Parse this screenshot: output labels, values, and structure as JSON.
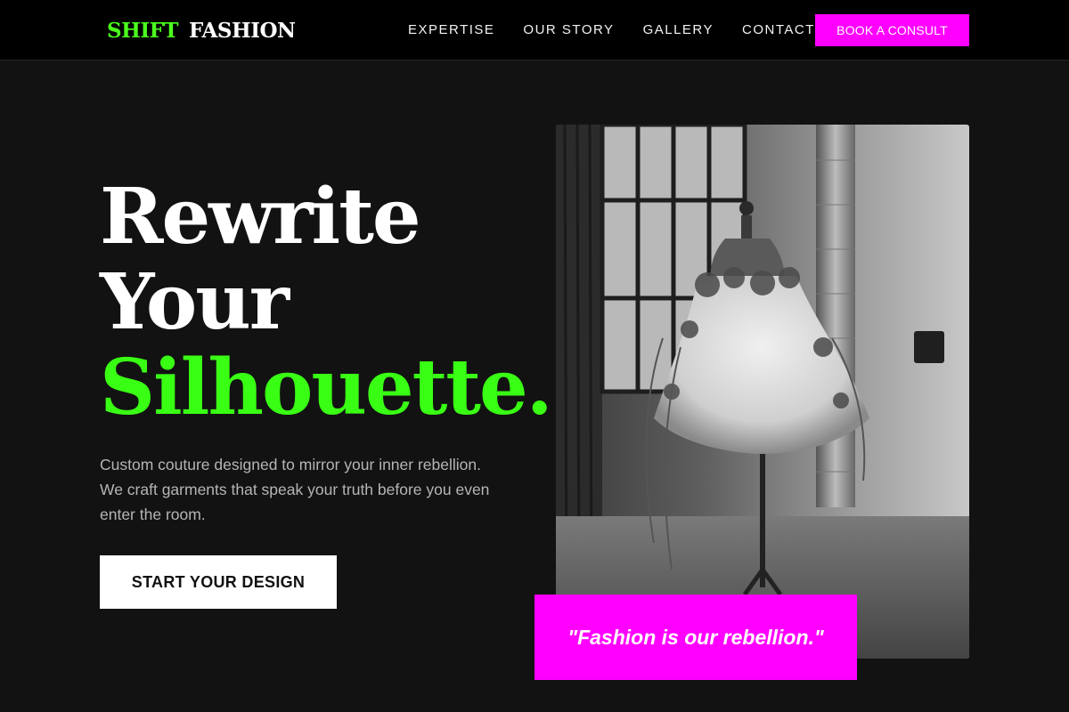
{
  "brand": {
    "name_part1": "SHIFT",
    "name_part2": "FASHION"
  },
  "nav": {
    "items": [
      {
        "label": "EXPERTISE"
      },
      {
        "label": "OUR STORY"
      },
      {
        "label": "GALLERY"
      },
      {
        "label": "CONTACT"
      }
    ],
    "cta_label": "BOOK A CONSULT"
  },
  "hero": {
    "headline_line1": "Rewrite",
    "headline_line2": "Your",
    "headline_accent": "Silhouette.",
    "subtext": "Custom couture designed to mirror your inner rebellion. We craft garments that speak your truth before you even enter the room.",
    "cta_label": "START YOUR DESIGN"
  },
  "quote": {
    "text": "\"Fashion is our rebellion.\""
  },
  "colors": {
    "background": "#121212",
    "nav_background": "#000000",
    "accent_green": "#39ff14",
    "accent_magenta": "#ff00ff",
    "text_white": "#ffffff",
    "text_muted": "#b5b5b5"
  }
}
